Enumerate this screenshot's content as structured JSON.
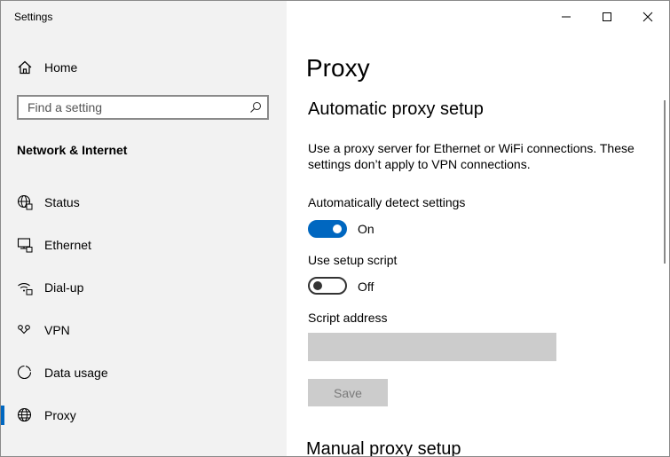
{
  "window": {
    "title": "Settings",
    "controls": {
      "minimize": "minimize",
      "maximize": "maximize",
      "close": "close"
    }
  },
  "sidebar": {
    "home_label": "Home",
    "search": {
      "placeholder": "Find a setting",
      "value": ""
    },
    "section_title": "Network & Internet",
    "items": [
      {
        "label": "Status",
        "icon": "globe-status-icon"
      },
      {
        "label": "Ethernet",
        "icon": "ethernet-icon"
      },
      {
        "label": "Dial-up",
        "icon": "dial-up-icon"
      },
      {
        "label": "VPN",
        "icon": "vpn-icon"
      },
      {
        "label": "Data usage",
        "icon": "data-usage-icon"
      },
      {
        "label": "Proxy",
        "icon": "globe-icon",
        "selected": true
      }
    ]
  },
  "main": {
    "page_title": "Proxy",
    "auto_section": {
      "heading": "Automatic proxy setup",
      "description": "Use a proxy server for Ethernet or WiFi connections. These settings don’t apply to VPN connections.",
      "auto_detect": {
        "label": "Automatically detect settings",
        "state": "On",
        "on": true
      },
      "setup_script": {
        "label": "Use setup script",
        "state": "Off",
        "on": false
      },
      "script_address": {
        "label": "Script address",
        "value": ""
      },
      "save_label": "Save"
    },
    "manual_section": {
      "heading": "Manual proxy setup"
    }
  },
  "colors": {
    "accent": "#0067c0",
    "sidebar_bg": "#f2f2f2",
    "disabled": "#cccccc"
  }
}
